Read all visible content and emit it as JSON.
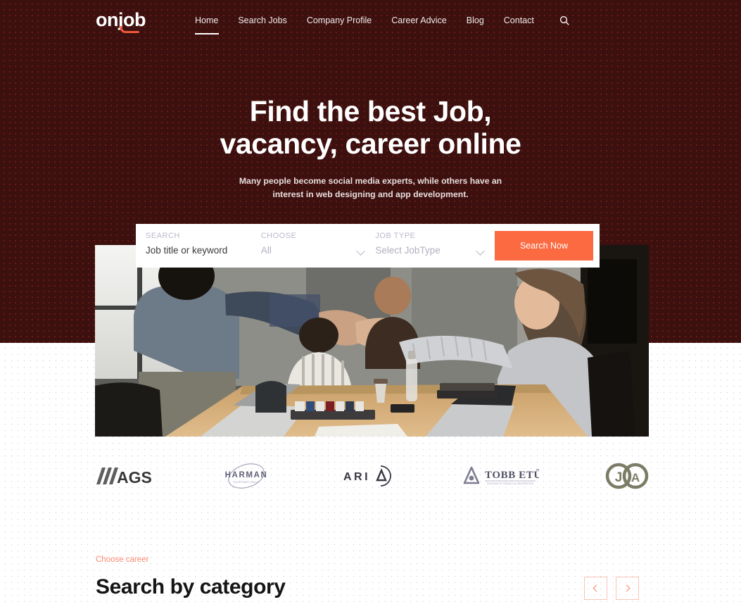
{
  "brand": {
    "logo_text": "onjob",
    "accent_color": "#f0593a"
  },
  "nav": {
    "items": [
      {
        "label": "Home",
        "active": true
      },
      {
        "label": "Search Jobs",
        "active": false
      },
      {
        "label": "Company Profile",
        "active": false
      },
      {
        "label": "Career Advice",
        "active": false
      },
      {
        "label": "Blog",
        "active": false
      },
      {
        "label": "Contact",
        "active": false
      }
    ],
    "search_icon": "search-icon"
  },
  "hero": {
    "title_line1": "Find the best Job,",
    "title_line2": "vacancy, career online",
    "subtitle_line1": "Many people become social media experts, while others have an",
    "subtitle_line2": "interest in web designing and app development.",
    "background_color": "#3b100e",
    "photo_alt": "office team shaking hands across a conference table"
  },
  "search_panel": {
    "fields": [
      {
        "label": "SEARCH",
        "value": "Job title or keyword",
        "muted": false,
        "has_caret": false
      },
      {
        "label": "CHOOSE",
        "value": "All",
        "muted": true,
        "has_caret": true
      },
      {
        "label": "JOB TYPE",
        "value": "Select JobType",
        "muted": true,
        "has_caret": true
      }
    ],
    "button_label": "Search Now",
    "button_color": "#fb6a41"
  },
  "brands": {
    "items": [
      {
        "name": "AGS"
      },
      {
        "name": "HARMAN"
      },
      {
        "name": "ARIA"
      },
      {
        "name": "TOBB ETÜ"
      },
      {
        "name": "J/A"
      }
    ]
  },
  "category_section": {
    "eyebrow": "Choose career",
    "title": "Search by category",
    "prev_label": "‹",
    "next_label": "›"
  }
}
